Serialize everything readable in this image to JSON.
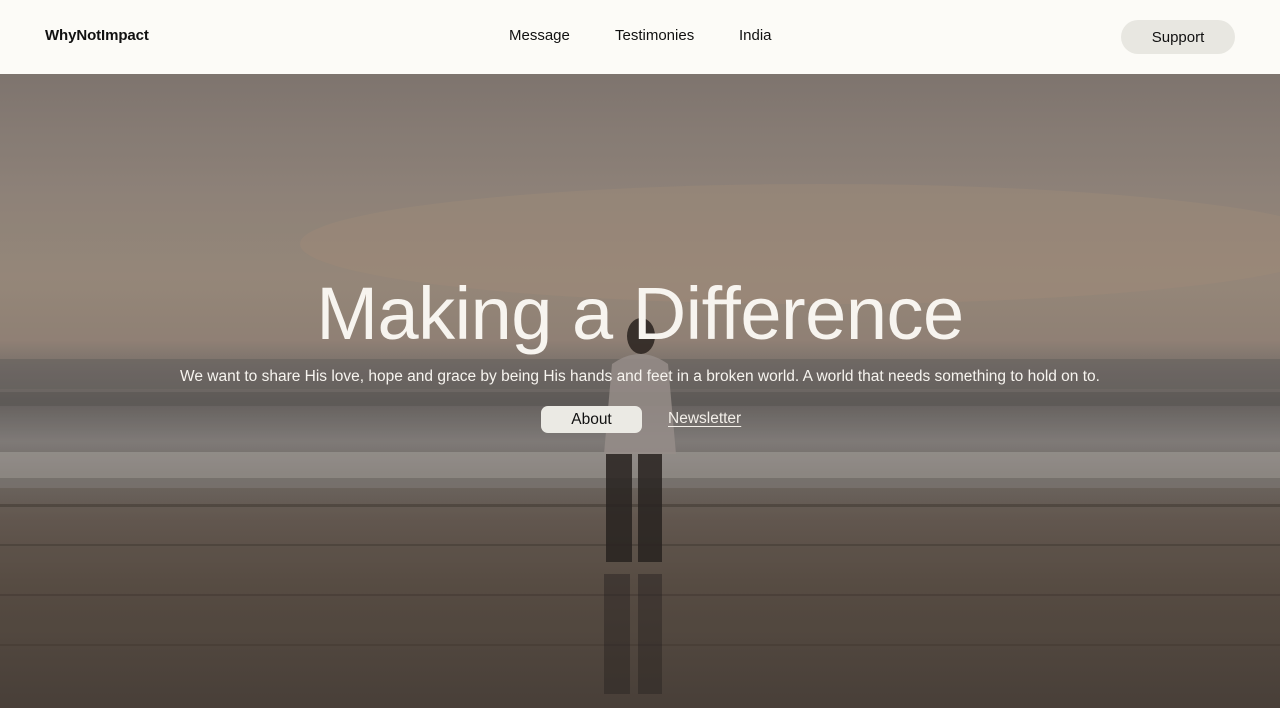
{
  "header": {
    "brand": "WhyNotImpact",
    "nav": [
      {
        "label": "Message"
      },
      {
        "label": "Testimonies"
      },
      {
        "label": "India"
      }
    ],
    "support_label": "Support"
  },
  "hero": {
    "title": "Making a Difference",
    "subtitle": "We want to share His love, hope and grace by being His hands and feet in a broken world. A world that needs something to hold on to.",
    "about_label": "About",
    "newsletter_label": "Newsletter"
  },
  "colors": {
    "topbar_bg": "#fcfbf7",
    "button_bg": "#e8e7e1",
    "hero_text": "#f7f4ef"
  }
}
